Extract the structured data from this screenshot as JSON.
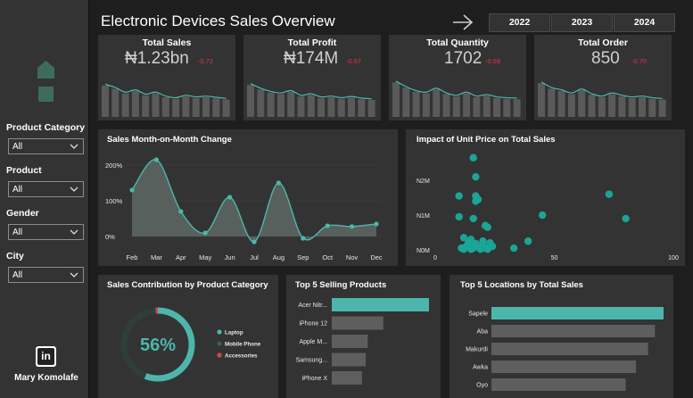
{
  "app": {
    "title": "Electronic Devices Sales Overview"
  },
  "years": [
    "2022",
    "2023",
    "2024"
  ],
  "filters": [
    {
      "label": "Product Category",
      "value": "All"
    },
    {
      "label": "Product",
      "value": "All"
    },
    {
      "label": "Gender",
      "value": "All"
    },
    {
      "label": "City",
      "value": "All"
    }
  ],
  "author": {
    "name": "Mary Komolafe",
    "icon": "linkedin-icon",
    "icon_text": "in"
  },
  "colors": {
    "accent": "#4db6ac",
    "bar": "#5e5e5e",
    "card": "#333333",
    "negative": "#e0354a",
    "page": "#1e1e1e"
  },
  "kpis": [
    {
      "title": "Total Sales",
      "value": "₦1.23bn",
      "delta": "-0.72"
    },
    {
      "title": "Total Profit",
      "value": "₦174M",
      "delta": "-0.67"
    },
    {
      "title": "Total Quantity",
      "value": "1702",
      "delta": "-0.69"
    },
    {
      "title": "Total Order",
      "value": "850",
      "delta": "-0.70"
    }
  ],
  "chart_data": [
    {
      "type": "area",
      "title": "Sales Month-on-Month Change",
      "categories": [
        "Feb",
        "Mar",
        "Apr",
        "May",
        "Jun",
        "Jul",
        "Aug",
        "Sep",
        "Oct",
        "Nov",
        "Dec"
      ],
      "values": [
        130,
        215,
        70,
        10,
        110,
        -15,
        150,
        -5,
        30,
        28,
        35
      ],
      "yticks": [
        "200%",
        "100%",
        "0%"
      ],
      "ytick_values": [
        200,
        100,
        0
      ],
      "ylim": [
        -30,
        230
      ]
    },
    {
      "type": "scatter",
      "title": "Impact of Unit Price on Total Sales",
      "xticks": [
        "0",
        "50",
        "100"
      ],
      "xtick_values": [
        0,
        50,
        100
      ],
      "yticks": [
        "N2M",
        "N1M",
        "N0M"
      ],
      "ytick_values": [
        2,
        1,
        0
      ],
      "xlim": [
        0,
        100
      ],
      "ylim": [
        0,
        2.9
      ],
      "points": [
        [
          16,
          2.65
        ],
        [
          17,
          2.1
        ],
        [
          10,
          1.55
        ],
        [
          17,
          1.55
        ],
        [
          17,
          1.4
        ],
        [
          18,
          1.45
        ],
        [
          10,
          0.95
        ],
        [
          16,
          0.9
        ],
        [
          21,
          0.7
        ],
        [
          22,
          0.65
        ],
        [
          45,
          1.0
        ],
        [
          73,
          1.6
        ],
        [
          80,
          0.9
        ],
        [
          39,
          0.25
        ],
        [
          33,
          0.05
        ],
        [
          12,
          0.35
        ],
        [
          15,
          0.3
        ],
        [
          20,
          0.25
        ],
        [
          14,
          0.15
        ],
        [
          13,
          0.1
        ],
        [
          18,
          0.1
        ],
        [
          11,
          0.05
        ],
        [
          16,
          0.05
        ],
        [
          21,
          0.05
        ],
        [
          23,
          0.2
        ],
        [
          24,
          0.1
        ],
        [
          12,
          0.02
        ],
        [
          15,
          0.02
        ],
        [
          19,
          0.02
        ],
        [
          22,
          0.02
        ],
        [
          14,
          0.22
        ],
        [
          17,
          0.18
        ],
        [
          20,
          0.12
        ]
      ]
    },
    {
      "type": "pie",
      "title": "Sales Contribution by Product Category",
      "center_label": "56%",
      "slices": [
        {
          "name": "Laptop",
          "value": 56,
          "color": "#4db6ac"
        },
        {
          "name": "Mobile Phone",
          "value": 43,
          "color": "#2f3d3b"
        },
        {
          "name": "Accessories",
          "value": 1,
          "color": "#c94a55"
        }
      ]
    },
    {
      "type": "bar",
      "orientation": "horizontal",
      "title": "Top 5 Selling Products",
      "categories": [
        "Acer Nitr...",
        "iPhone 12",
        "Apple M...",
        "Samsung...",
        "iPhone X"
      ],
      "values": [
        100,
        53,
        37,
        35,
        31
      ]
    },
    {
      "type": "bar",
      "orientation": "horizontal",
      "title": "Top 5 Locations by Total Sales",
      "categories": [
        "Sapele",
        "Aba",
        "Makurdi",
        "Awka",
        "Oyo"
      ],
      "values": [
        100,
        95,
        91,
        84,
        78
      ]
    }
  ]
}
